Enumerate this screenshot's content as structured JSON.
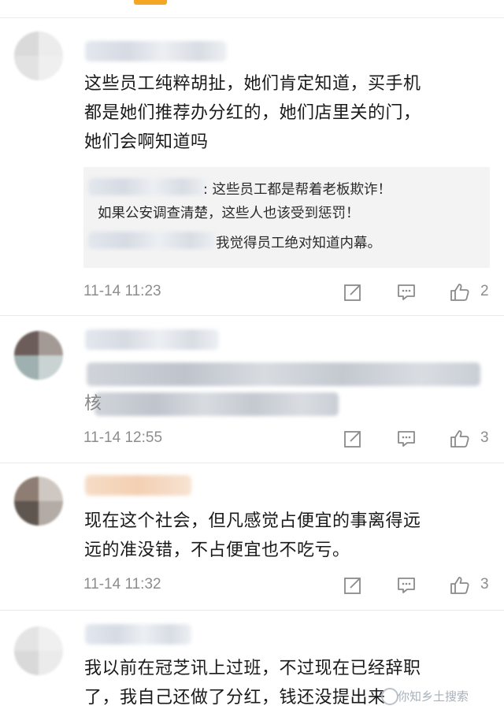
{
  "comments": [
    {
      "text_lines": [
        "这些员工纯粹胡扯，她们肯定知道，买手机",
        "都是她们推荐办分红的，她们店里关的门，",
        "她们会啊知道吗"
      ],
      "replies": [
        ": 这些员工都是帮着老板欺诈！",
        "如果公安调查清楚，这些人也该受到惩罚！",
        "我觉得员工绝对知道内幕。"
      ],
      "timestamp": "11-14 11:23",
      "likes": "2"
    },
    {
      "text_lines": [
        "核"
      ],
      "timestamp": "11-14 12:55",
      "likes": "3"
    },
    {
      "text_lines": [
        "现在这个社会，但凡感觉占便宜的事离得远",
        "远的准没错，不占便宜也不吃亏。"
      ],
      "timestamp": "11-14 11:32",
      "likes": "3"
    },
    {
      "text_lines": [
        "我以前在冠芝讯上过班，不过现在已经辞职",
        "了，我自己还做了分红，钱还没提出来"
      ]
    }
  ],
  "icons": {
    "edit": "edit-icon",
    "comment": "comment-icon",
    "like": "thumbs-up-icon"
  },
  "watermark": "你知乡土搜索",
  "colors": {
    "tab_indicator": "#f5a623",
    "meta_text": "#8d8d8d",
    "quote_bg": "#f3f3f3"
  }
}
